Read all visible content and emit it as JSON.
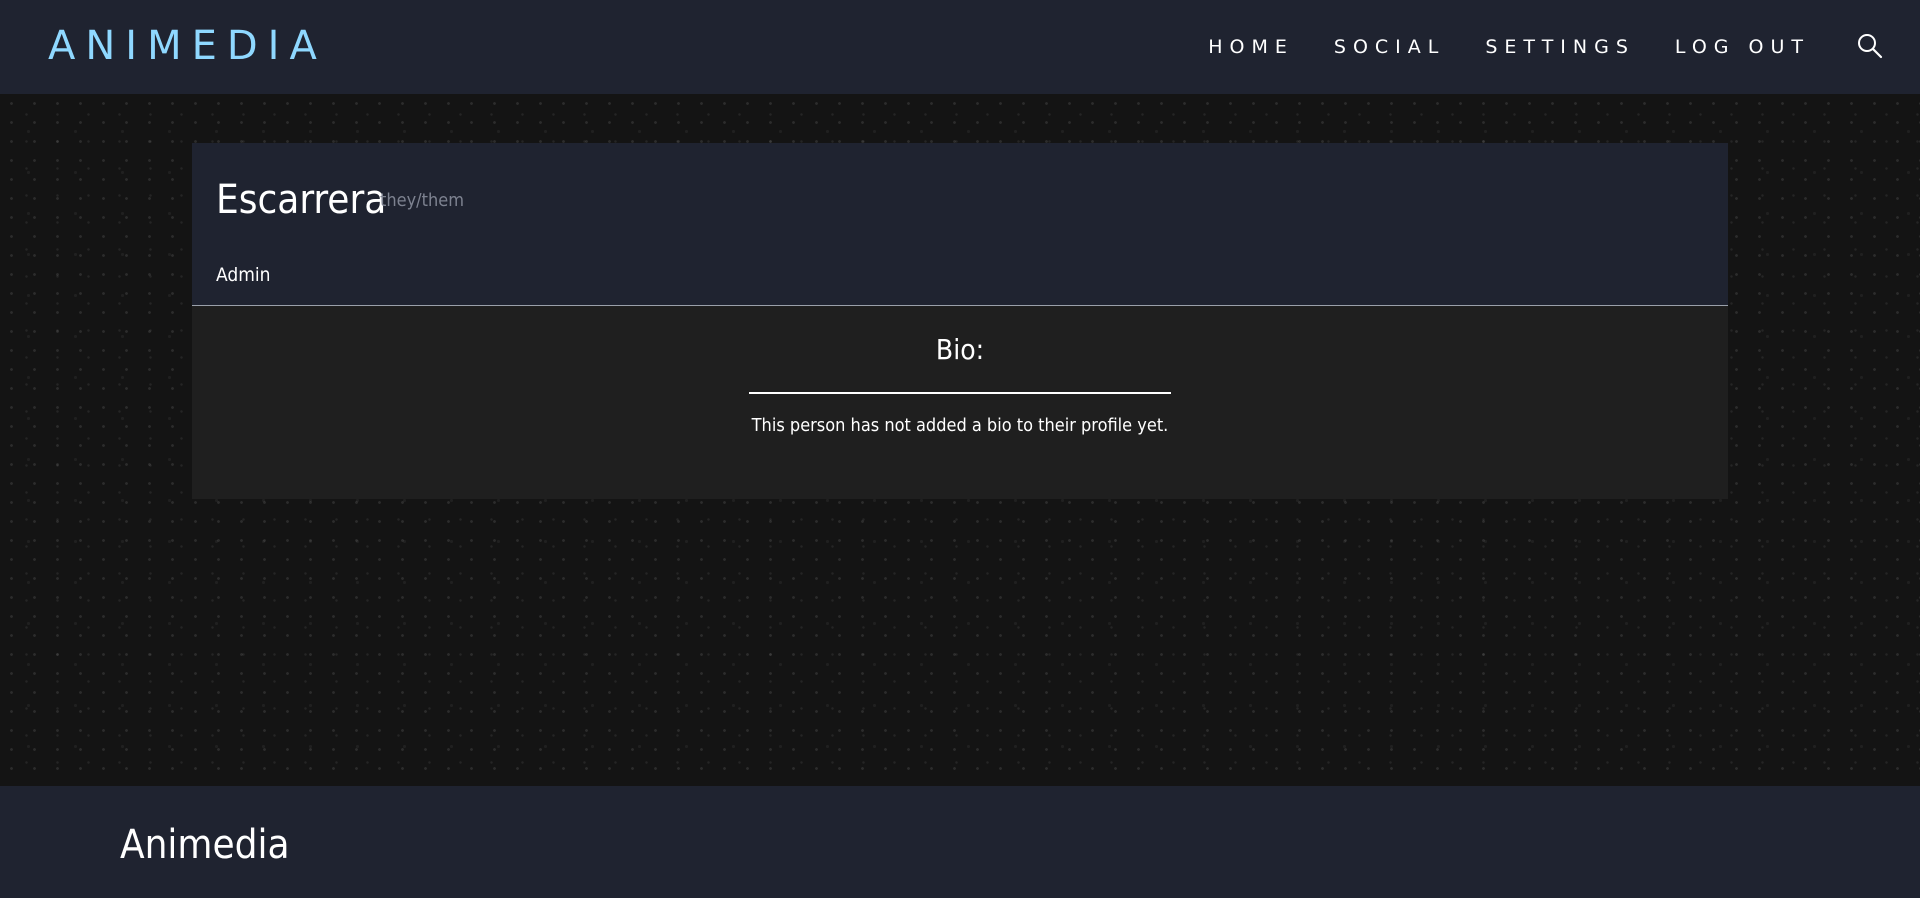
{
  "navbar": {
    "brand": "ANIMEDIA",
    "links": [
      {
        "label": "HOME"
      },
      {
        "label": "SOCIAL"
      },
      {
        "label": "SETTINGS"
      },
      {
        "label": "LOG OUT"
      }
    ],
    "search_icon": "search-icon"
  },
  "profile": {
    "username": "Escarrera",
    "pronouns": "they/them",
    "role": "Admin",
    "bio_heading": "Bio:",
    "bio_text": "This person has not added a bio to their profile yet."
  },
  "footer": {
    "brand": "Animedia"
  },
  "colors": {
    "accent": "#8fd8ff",
    "panel": "#1f2330",
    "body_panel": "#1f1f1f",
    "background": "#141414"
  }
}
